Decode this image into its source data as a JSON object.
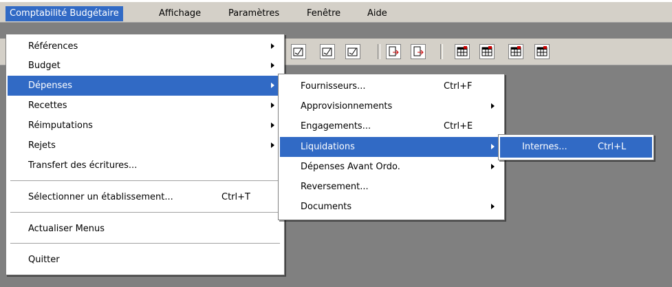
{
  "menubar": {
    "items": [
      {
        "label": "Comptabilité Budgétaire"
      },
      {
        "label": "Affichage"
      },
      {
        "label": "Paramètres"
      },
      {
        "label": "Fenêtre"
      },
      {
        "label": "Aide"
      }
    ]
  },
  "menu_main": {
    "items": [
      {
        "label": "Références"
      },
      {
        "label": "Budget"
      },
      {
        "label": "Dépenses"
      },
      {
        "label": "Recettes"
      },
      {
        "label": "Réimputations"
      },
      {
        "label": "Rejets"
      },
      {
        "label": "Transfert des écritures..."
      },
      {
        "label": "Sélectionner un établissement...",
        "shortcut": "Ctrl+T"
      },
      {
        "label": "Actualiser Menus"
      },
      {
        "label": "Quitter"
      }
    ]
  },
  "menu_depenses": {
    "items": [
      {
        "label": "Fournisseurs...",
        "shortcut": "Ctrl+F"
      },
      {
        "label": "Approvisionnements"
      },
      {
        "label": "Engagements...",
        "shortcut": "Ctrl+E"
      },
      {
        "label": "Liquidations"
      },
      {
        "label": "Dépenses Avant Ordo."
      },
      {
        "label": "Reversement..."
      },
      {
        "label": "Documents"
      }
    ]
  },
  "menu_liquidations": {
    "items": [
      {
        "label": "Internes...",
        "shortcut": "Ctrl+L"
      }
    ]
  },
  "colors": {
    "selection": "#316ac5",
    "menubar_bg": "#d4d0c8",
    "workspace_bg": "#808080"
  }
}
